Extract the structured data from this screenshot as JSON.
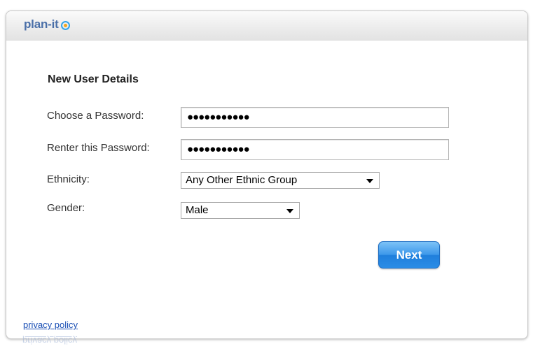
{
  "header": {
    "logo_text": "plan-it",
    "logo_icon": "target-icon"
  },
  "form": {
    "title": "New User Details",
    "password_label": "Choose a Password:",
    "password_value": "●●●●●●●●●●●",
    "reenter_label": "Renter this Password:",
    "reenter_value": "●●●●●●●●●●●",
    "ethnicity_label": "Ethnicity:",
    "ethnicity_value": "Any Other Ethnic Group",
    "gender_label": "Gender:",
    "gender_value": "Male",
    "next_label": "Next"
  },
  "footer": {
    "privacy_link": "privacy policy"
  },
  "colors": {
    "accent": "#2a8ce6",
    "link": "#1a4fb5",
    "logo": "#4a6fa8"
  }
}
